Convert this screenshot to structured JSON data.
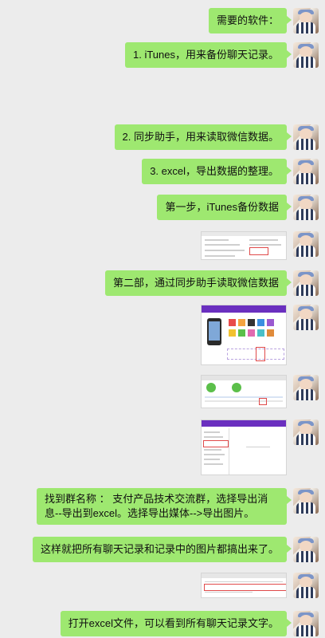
{
  "messages": [
    {
      "text": "需要的软件："
    },
    {
      "text": "1. iTunes，用来备份聊天记录。"
    },
    {
      "text": "2. 同步助手，用来读取微信数据。"
    },
    {
      "text": "3. excel，导出数据的整理。"
    },
    {
      "text": "第一步，iTunes备份数据"
    },
    {
      "text": "第二部，通过同步助手读取微信数据"
    },
    {
      "text": "找到群名称 ： 支付产品技术交流群，选择导出消息--导出到excel。选择导出媒体-->导出图片。"
    },
    {
      "text": "这样就把所有聊天记录和记录中的图片都搞出来了。"
    },
    {
      "text": "打开excel文件，可以看到所有聊天记录文字。"
    }
  ],
  "colors": {
    "background": "#ececec",
    "bubble": "#9ee870",
    "tool_purple": "#6a2fbf"
  }
}
